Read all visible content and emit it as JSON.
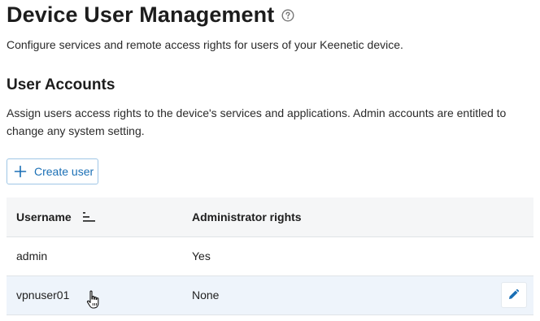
{
  "page": {
    "title": "Device User Management",
    "description": "Configure services and remote access rights for users of your Keenetic device."
  },
  "section": {
    "title": "User Accounts",
    "description": "Assign users access rights to the device's services and applications. Admin accounts are entitled to change any system setting."
  },
  "toolbar": {
    "create_label": "Create user"
  },
  "table": {
    "headers": {
      "username": "Username",
      "admin_rights": "Administrator rights"
    },
    "rows": [
      {
        "username": "admin",
        "admin_rights": "Yes"
      },
      {
        "username": "vpnuser01",
        "admin_rights": "None"
      }
    ]
  },
  "colors": {
    "accent": "#1a6fb5",
    "header_bg": "#f5f6f7",
    "row_highlight": "#eef4fb",
    "border": "#dfe3e7"
  },
  "icons": [
    "help-icon",
    "plus-icon",
    "sort-icon",
    "pencil-icon",
    "hand-cursor-icon"
  ]
}
